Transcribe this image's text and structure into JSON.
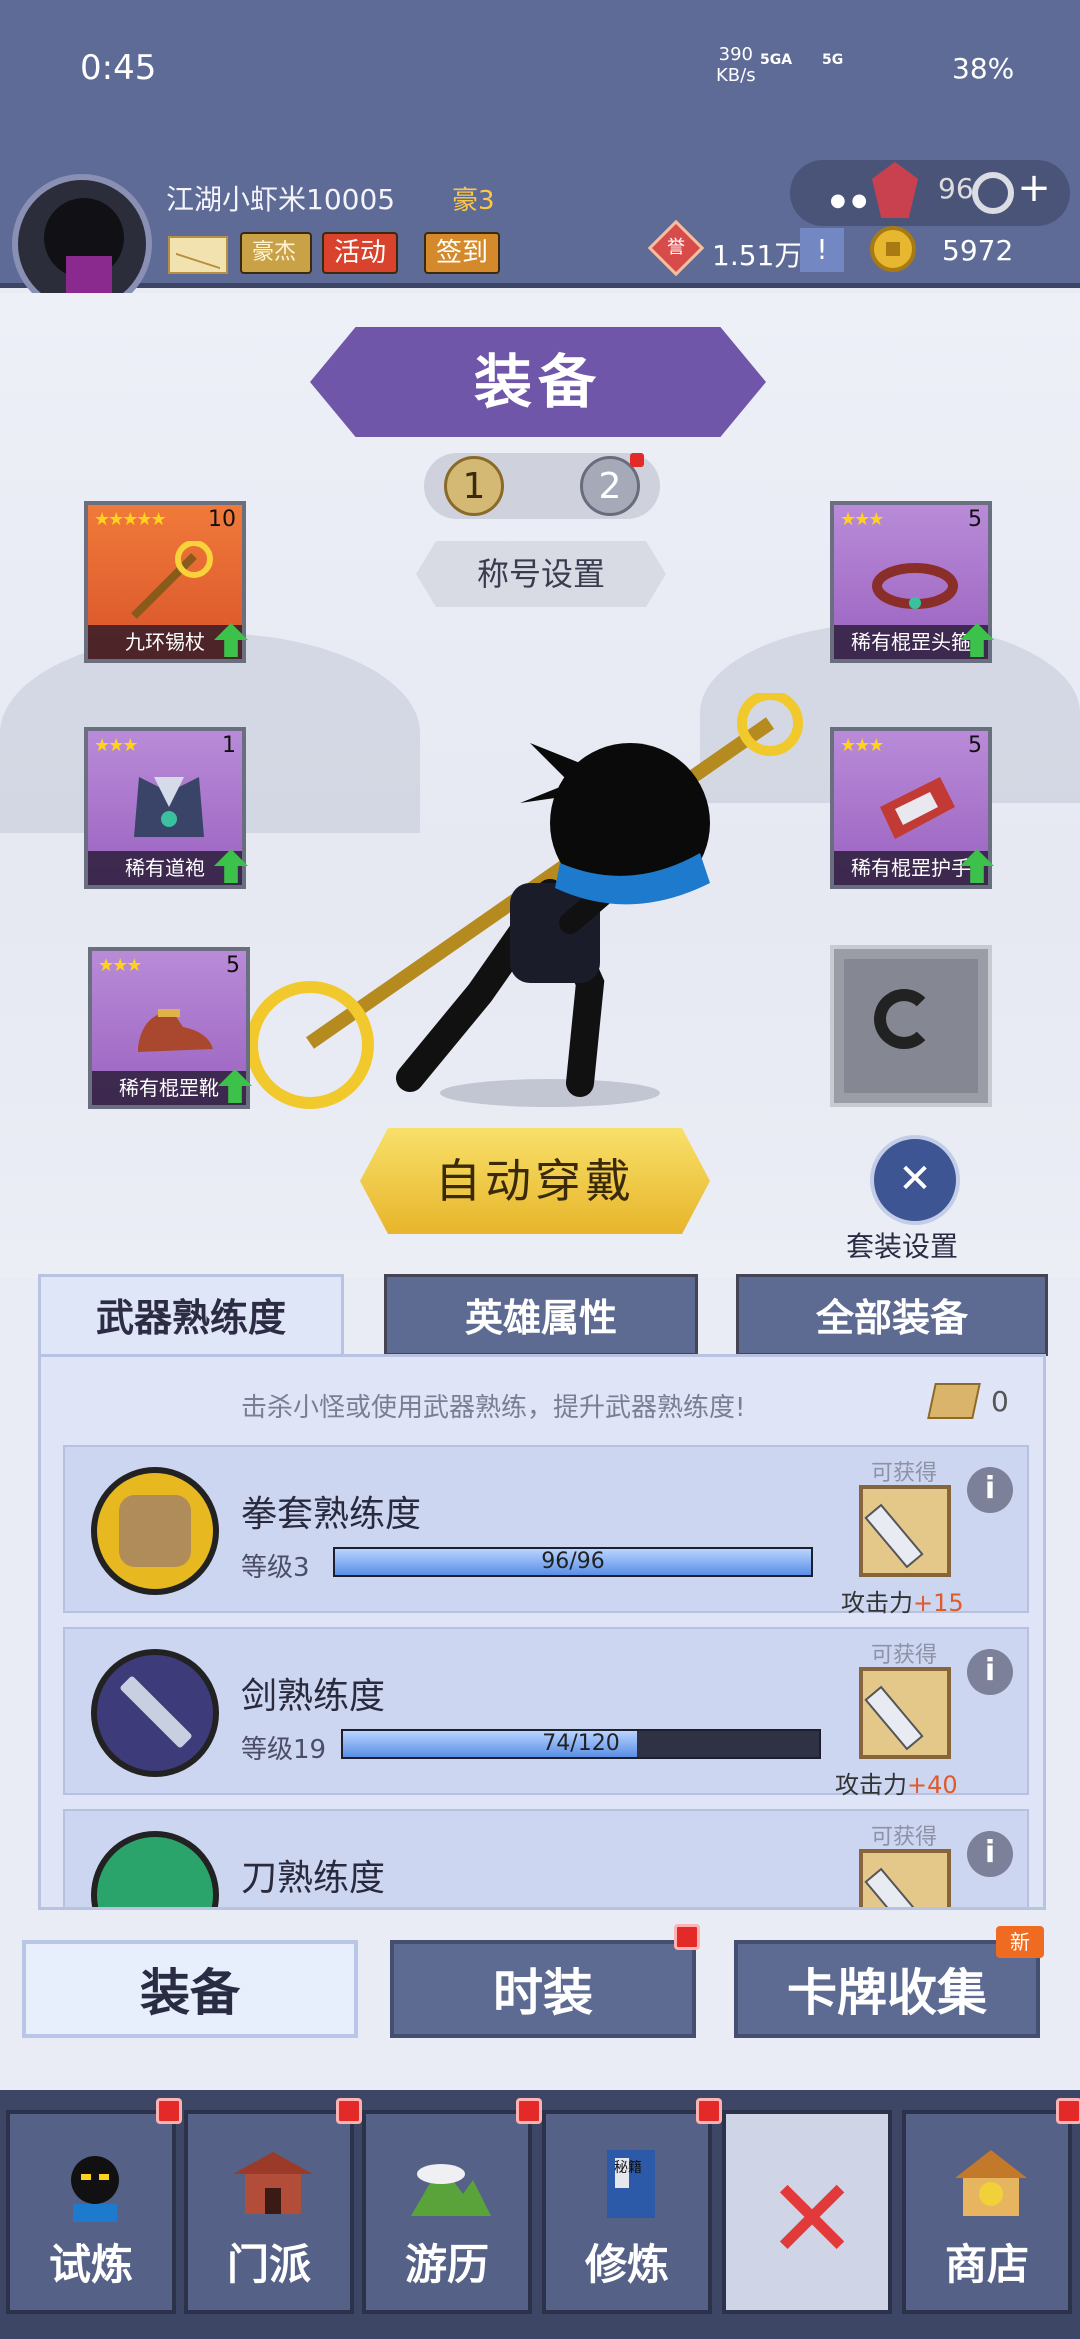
{
  "status_bar": {
    "time": "0:45",
    "speed_value": "390",
    "speed_unit": "KB/s",
    "signal1": "5GA",
    "signal2": "5G",
    "battery": "38%"
  },
  "header": {
    "username": "江湖小虾米10005",
    "rank": "豪3",
    "buttons": {
      "hero": "豪杰",
      "activity": "活动",
      "signin": "签到"
    },
    "gems": "96",
    "silver_icon_text": "誉",
    "silver": "1.51万",
    "alert": "!",
    "gold": "5972",
    "colors": {
      "header_bg": "#5e6b96",
      "accent_purple": "#6f56a8"
    }
  },
  "equipment": {
    "title": "装备",
    "pages": [
      "1",
      "2"
    ],
    "title_settings": "称号设置",
    "slots": [
      {
        "name": "九环锡杖",
        "stars": "★★★★★",
        "level": "10",
        "rarity": "orange"
      },
      {
        "name": "稀有道袍",
        "stars": "★★★",
        "level": "1",
        "rarity": "purple"
      },
      {
        "name": "稀有棍罡靴",
        "stars": "★★★",
        "level": "5",
        "rarity": "purple"
      },
      {
        "name": "稀有棍罡头箍",
        "stars": "★★★",
        "level": "5",
        "rarity": "purple"
      },
      {
        "name": "稀有棍罡护手",
        "stars": "★★★",
        "level": "5",
        "rarity": "purple"
      }
    ],
    "auto_equip": "自动穿戴",
    "suit_settings": "套装设置"
  },
  "tabs": [
    "武器熟练度",
    "英雄属性",
    "全部装备"
  ],
  "proficiency": {
    "hint": "击杀小怪或使用武器熟练，提升武器熟练度!",
    "scroll_count": "0",
    "rows": [
      {
        "name": "拳套熟练度",
        "level": "等级3",
        "progress": "96/96",
        "fill": 1.0,
        "obtain": "可获得",
        "reward_label": "攻击力",
        "reward_value": "+15",
        "icon": "fist-icon"
      },
      {
        "name": "剑熟练度",
        "level": "等级19",
        "progress": "74/120",
        "fill": 0.6167,
        "obtain": "可获得",
        "reward_label": "攻击力",
        "reward_value": "+40",
        "icon": "sword-icon"
      },
      {
        "name": "刀熟练度",
        "level": "",
        "progress": "",
        "fill": 0,
        "obtain": "可获得",
        "reward_label": "",
        "reward_value": "",
        "icon": "blade-icon"
      }
    ]
  },
  "subtabs": [
    "装备",
    "时装",
    "卡牌收集"
  ],
  "new_badge": "新",
  "bottom_nav": [
    {
      "label": "试炼",
      "icon": "ninja-icon"
    },
    {
      "label": "门派",
      "icon": "temple-icon"
    },
    {
      "label": "游历",
      "icon": "mountain-icon"
    },
    {
      "label": "修炼",
      "icon": "book-icon"
    },
    {
      "label": "",
      "icon": "close-icon"
    },
    {
      "label": "商店",
      "icon": "shop-icon"
    }
  ],
  "book_icon_text": "秘籍"
}
